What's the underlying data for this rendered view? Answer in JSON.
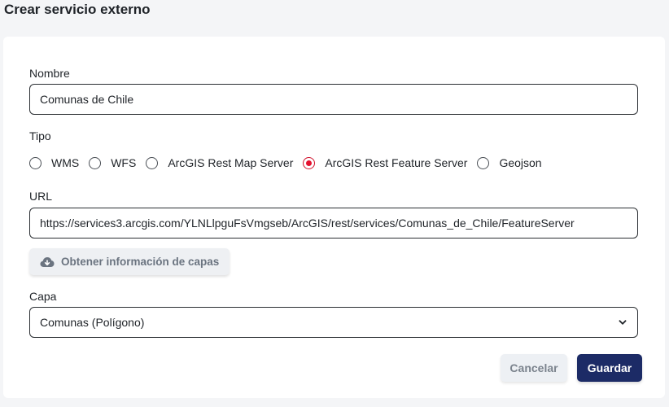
{
  "page": {
    "title": "Crear servicio externo"
  },
  "form": {
    "nombre": {
      "label": "Nombre",
      "value": "Comunas de Chile"
    },
    "tipo": {
      "label": "Tipo",
      "options": [
        {
          "label": "WMS",
          "selected": false
        },
        {
          "label": "WFS",
          "selected": false
        },
        {
          "label": "ArcGIS Rest Map Server",
          "selected": false
        },
        {
          "label": "ArcGIS Rest Feature Server",
          "selected": true
        },
        {
          "label": "Geojson",
          "selected": false
        }
      ]
    },
    "url": {
      "label": "URL",
      "value": "https://services3.arcgis.com/YLNLlpguFsVmgseb/ArcGIS/rest/services/Comunas_de_Chile/FeatureServer"
    },
    "fetch_button": {
      "label": "Obtener información de capas",
      "icon": "cloud-download-icon"
    },
    "capa": {
      "label": "Capa",
      "value": "Comunas (Polígono)",
      "icon": "chevron-down-icon"
    }
  },
  "actions": {
    "cancel_label": "Cancelar",
    "save_label": "Guardar"
  },
  "colors": {
    "primary": "#1c2b66",
    "radio_selected": "#e5112f",
    "secondary_button_bg": "#edf0f4",
    "page_bg": "#f4f5f7"
  }
}
